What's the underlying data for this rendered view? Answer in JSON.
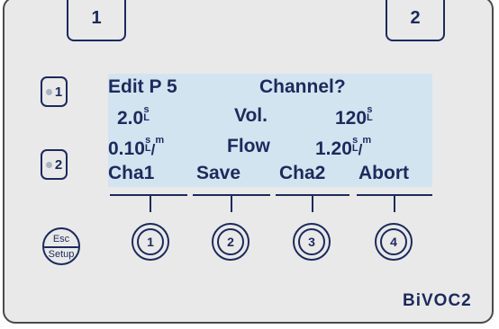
{
  "tabs": [
    "1",
    "2"
  ],
  "side_buttons": [
    "1",
    "2"
  ],
  "lcd": {
    "line1": {
      "left": "Edit P 5",
      "right": "Channel?"
    },
    "line2": {
      "val1": "2.0",
      "label": "Vol.",
      "val2": "120",
      "unit_top": "s",
      "unit_bottom": "L"
    },
    "line3": {
      "val1": "0.10",
      "label": "Flow",
      "val2": "1.20",
      "unit_top": "s",
      "unit_bottom": "L",
      "per_unit": "m"
    },
    "softkeys": [
      "Cha1",
      "Save",
      "Cha2",
      "Abort"
    ]
  },
  "round_buttons": [
    "1",
    "2",
    "3",
    "4"
  ],
  "esc_button": {
    "top": "Esc",
    "bottom": "Setup"
  },
  "brand": "BiVOC2",
  "colors": {
    "ink": "#1c2a5c",
    "panel": "#e9e9e9",
    "lcd": "#d3e4f1",
    "led": "#a8b4c4"
  }
}
